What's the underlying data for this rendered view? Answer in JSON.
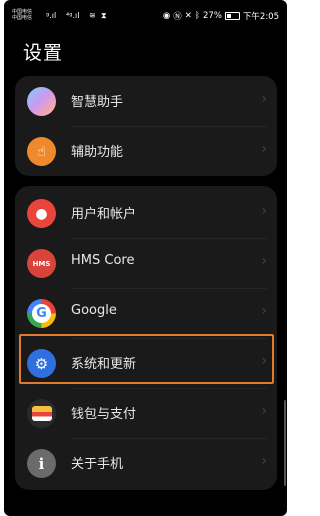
{
  "status_bar": {
    "carrier_1": "中国电信",
    "carrier_2": "中国电信",
    "right_text": "27%",
    "time": "下午2:05"
  },
  "page": {
    "title": "设置"
  },
  "group1": [
    {
      "label": "智慧助手",
      "icon": "assistant-icon"
    },
    {
      "label": "辅助功能",
      "icon": "hand-pointer-icon"
    }
  ],
  "group2": [
    {
      "label": "用户和帐户",
      "icon": "user-icon"
    },
    {
      "label": "HMS Core",
      "icon": "hms-icon",
      "icon_text": "HMS"
    },
    {
      "label": "Google",
      "icon": "google-icon",
      "icon_text": "G"
    },
    {
      "label": "系统和更新",
      "icon": "gear-icon"
    },
    {
      "label": "钱包与支付",
      "icon": "wallet-icon"
    },
    {
      "label": "关于手机",
      "icon": "info-icon",
      "icon_text": "i"
    }
  ],
  "colors": {
    "highlight": "#e07a2d",
    "user": "#e8453c",
    "hms": "#d9443a",
    "system": "#2f6fe0",
    "assist": "#ee8a2c",
    "info": "#6b6b6b"
  }
}
